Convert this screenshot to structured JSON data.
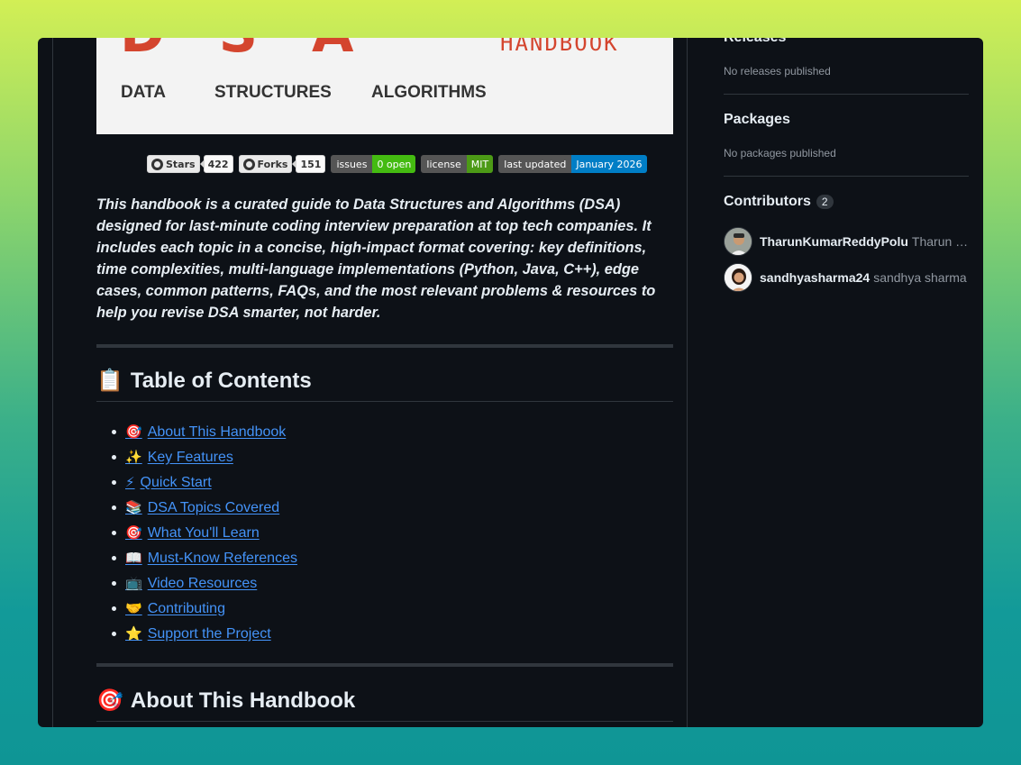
{
  "banner": {
    "logo_letters": "DSA",
    "handbook_label": "HANDBOOK",
    "word1": "DATA",
    "word2": "STRUCTURES",
    "word3": "ALGORITHMS"
  },
  "badges": {
    "stars_label": "Stars",
    "stars_count": "422",
    "forks_label": "Forks",
    "forks_count": "151",
    "issues_key": "issues",
    "issues_value": "0 open",
    "license_key": "license",
    "license_value": "MIT",
    "updated_key": "last updated",
    "updated_value": "January 2026",
    "colors": {
      "issues": "#4c1",
      "license": "#4c9a16",
      "updated": "#007ec6"
    }
  },
  "description": "This handbook is a curated guide to Data Structures and Algorithms (DSA) designed for last-minute coding interview preparation at top tech companies. It includes each topic in a concise, high-impact format covering: key definitions, time complexities, multi-language implementations (Python, Java, C++), edge cases, common patterns, FAQs, and the most relevant problems & resources to help you revise DSA smarter, not harder.",
  "toc": {
    "emoji": "📋",
    "title": "Table of Contents",
    "items": [
      {
        "emoji": "🎯",
        "label": "About This Handbook"
      },
      {
        "emoji": "✨",
        "label": "Key Features"
      },
      {
        "emoji": "⚡",
        "label": "Quick Start"
      },
      {
        "emoji": "📚",
        "label": "DSA Topics Covered"
      },
      {
        "emoji": "🎯",
        "label": "What You'll Learn"
      },
      {
        "emoji": "📖",
        "label": "Must-Know References"
      },
      {
        "emoji": "📺",
        "label": "Video Resources"
      },
      {
        "emoji": "🤝",
        "label": "Contributing"
      },
      {
        "emoji": "⭐",
        "label": "Support the Project"
      }
    ]
  },
  "about": {
    "emoji": "🎯",
    "title": "About This Handbook"
  },
  "sidebar": {
    "releases_title": "Releases",
    "releases_text": "No releases published",
    "packages_title": "Packages",
    "packages_text": "No packages published",
    "contributors_title": "Contributors",
    "contributors_count": "2",
    "contributors": [
      {
        "login": "TharunKumarReddyPolu",
        "name": "Tharun Kumar Reddy Polu"
      },
      {
        "login": "sandhyasharma24",
        "name": "sandhya sharma"
      }
    ]
  }
}
